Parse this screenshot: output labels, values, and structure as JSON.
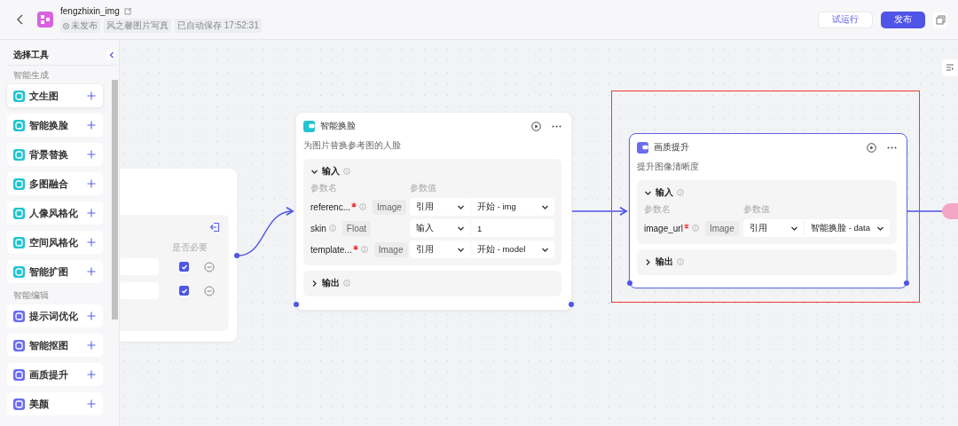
{
  "header": {
    "title": "fengzhixin_img",
    "status": "未发布",
    "tags": [
      "风之馨图片写真",
      "已自动保存 17:52:31"
    ],
    "actions": [
      {
        "label": "试运行",
        "kind": "secondary"
      },
      {
        "label": "发布",
        "kind": "primary"
      }
    ]
  },
  "sidebar": {
    "title": "选择工具",
    "sections": [
      {
        "title": "智能生成",
        "color": "#22c3d0",
        "items": [
          "文生图",
          "智能换脸",
          "背景替换",
          "多图融合",
          "人像风格化",
          "空间风格化",
          "智能扩图"
        ]
      },
      {
        "title": "智能编辑",
        "color": "#6b6cf0",
        "items": [
          "提示词优化",
          "智能抠图",
          "画质提升",
          "美颜"
        ]
      }
    ]
  },
  "canvas": {
    "nodes": [
      {
        "kind": "start",
        "column_header": "是否必要",
        "rows": [
          {
            "checked": true
          },
          {
            "checked": true
          }
        ]
      },
      {
        "kind": "tool",
        "title": "智能换脸",
        "description": "为图片替换参考图的人脸",
        "selected": false,
        "highlighted": false,
        "input": {
          "label": "输入",
          "expanded": true,
          "name_header": "参数名",
          "value_header": "参数值",
          "params": [
            {
              "name": "referenc...",
              "required": true,
              "type": "Image",
              "mode": "引用",
              "value": "开始 - img",
              "kind": "select"
            },
            {
              "name": "skin",
              "required": false,
              "type": "Float",
              "mode": "输入",
              "value": "1",
              "kind": "input"
            },
            {
              "name": "template...",
              "required": true,
              "type": "Image",
              "mode": "引用",
              "value": "开始 - model",
              "kind": "select"
            }
          ]
        },
        "output": {
          "label": "输出",
          "expanded": false
        }
      },
      {
        "kind": "tool",
        "title": "画质提升",
        "description": "提升图像清晰度",
        "selected": true,
        "highlighted": true,
        "input": {
          "label": "输入",
          "expanded": true,
          "name_header": "参数名",
          "value_header": "参数值",
          "params": [
            {
              "name": "image_url",
              "required": true,
              "type": "Image",
              "mode": "引用",
              "value": "智能换脸 - data",
              "kind": "select"
            }
          ]
        },
        "output": {
          "label": "输出",
          "expanded": false
        }
      }
    ]
  }
}
